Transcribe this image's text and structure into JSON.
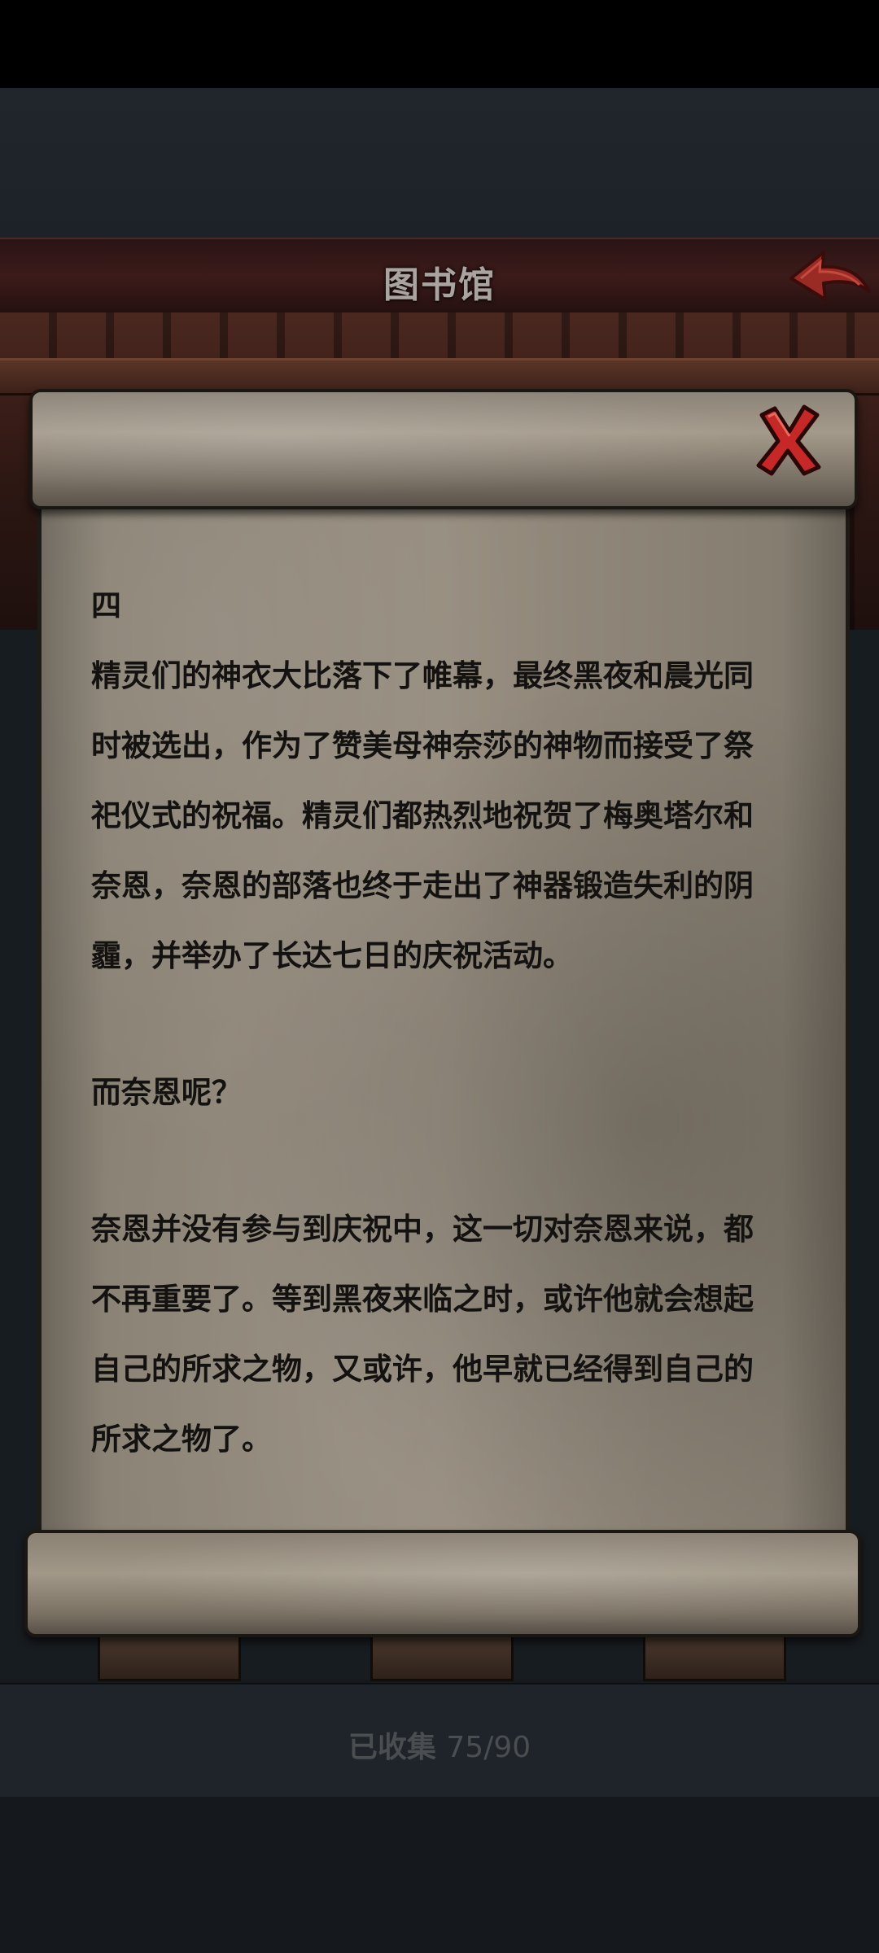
{
  "header": {
    "title": "图书馆"
  },
  "icons": {
    "back": "back-arrow-icon",
    "close": "close-x-icon"
  },
  "colors": {
    "header_bg": "#3b1b1a",
    "back_arrow": "#9a2a24",
    "close_x": "#c62828",
    "scroll_paper": "#968d7f",
    "text": "#141210"
  },
  "scroll": {
    "lines": [
      "四",
      "精灵们的神衣大比落下了帷幕，最终黑夜和晨光同",
      "时被选出，作为了赞美母神奈莎的神物而接受了祭",
      "祀仪式的祝福。精灵们都热烈地祝贺了梅奥塔尔和",
      "奈恩，奈恩的部落也终于走出了神器锻造失利的阴",
      "霾，并举办了长达七日的庆祝活动。",
      "而奈恩呢？",
      "奈恩并没有参与到庆祝中，这一切对奈恩来说，都",
      "不再重要了。等到黑夜来临之时，或许他就会想起",
      "自己的所求之物，又或许，他早就已经得到自己的",
      "所求之物了。"
    ]
  },
  "footer": {
    "collected_label": "已收集",
    "collected_count": "75/90"
  }
}
